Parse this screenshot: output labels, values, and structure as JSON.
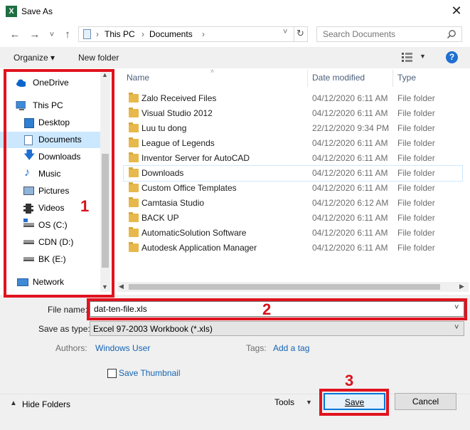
{
  "window": {
    "title": "Save As",
    "app_icon_letter": "X"
  },
  "nav": {
    "back_arrow": "←",
    "forward_arrow": "→",
    "recent_chevron": "˅",
    "up_arrow": "↑",
    "address": [
      "This PC",
      "Documents"
    ],
    "search_placeholder": "Search Documents"
  },
  "toolbar": {
    "organize": "Organize ▾",
    "new_folder": "New folder"
  },
  "sidebar": {
    "items": [
      {
        "label": "OneDrive"
      },
      {
        "label": "This PC"
      },
      {
        "label": "Desktop"
      },
      {
        "label": "Documents"
      },
      {
        "label": "Downloads"
      },
      {
        "label": "Music"
      },
      {
        "label": "Pictures"
      },
      {
        "label": "Videos"
      },
      {
        "label": "OS (C:)"
      },
      {
        "label": "CDN (D:)"
      },
      {
        "label": "BK (E:)"
      },
      {
        "label": "Network"
      }
    ]
  },
  "columns": {
    "name": "Name",
    "date": "Date modified",
    "type": "Type"
  },
  "files": [
    {
      "name": "Zalo Received Files",
      "date": "04/12/2020 6:11 AM",
      "type": "File folder"
    },
    {
      "name": "Visual Studio 2012",
      "date": "04/12/2020 6:11 AM",
      "type": "File folder"
    },
    {
      "name": "Luu tu dong",
      "date": "22/12/2020 9:34 PM",
      "type": "File folder"
    },
    {
      "name": "League of Legends",
      "date": "04/12/2020 6:11 AM",
      "type": "File folder"
    },
    {
      "name": "Inventor Server for AutoCAD",
      "date": "04/12/2020 6:11 AM",
      "type": "File folder"
    },
    {
      "name": "Downloads",
      "date": "04/12/2020 6:11 AM",
      "type": "File folder"
    },
    {
      "name": "Custom Office Templates",
      "date": "04/12/2020 6:11 AM",
      "type": "File folder"
    },
    {
      "name": "Camtasia Studio",
      "date": "04/12/2020 6:12 AM",
      "type": "File folder"
    },
    {
      "name": "BACK UP",
      "date": "04/12/2020 6:11 AM",
      "type": "File folder"
    },
    {
      "name": "AutomaticSolution Software",
      "date": "04/12/2020 6:11 AM",
      "type": "File folder"
    },
    {
      "name": "Autodesk Application Manager",
      "date": "04/12/2020 6:11 AM",
      "type": "File folder"
    }
  ],
  "form": {
    "filename_label": "File name:",
    "filename_value": "dat-ten-file.xls",
    "savetype_label": "Save as type:",
    "savetype_value": "Excel 97-2003 Workbook (*.xls)",
    "authors_label": "Authors:",
    "authors_value": "Windows User",
    "tags_label": "Tags:",
    "tags_value": "Add a tag",
    "save_thumbnail": "Save Thumbnail"
  },
  "footer": {
    "hide_folders": "Hide Folders",
    "tools": "Tools",
    "save": "Save",
    "cancel": "Cancel"
  },
  "annotations": {
    "one": "1",
    "two": "2",
    "three": "3"
  },
  "colors": {
    "highlight_red": "#e0131e",
    "accent_blue": "#1e6fd0",
    "selected": "#cce8ff"
  }
}
